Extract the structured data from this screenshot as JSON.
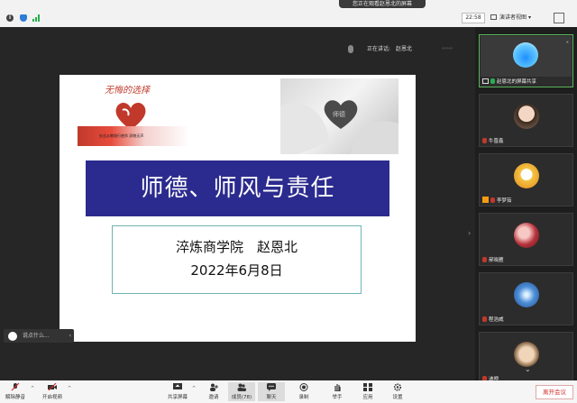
{
  "topbar": {
    "viewing_banner": "您正在观看赵恩北的屏幕",
    "time": "22:58",
    "view_mode": "演讲者视图"
  },
  "stage": {
    "speaking_label": "正在讲话:",
    "speaking_name": "赵恩北",
    "chat_placeholder": "说点什么...",
    "slide": {
      "brand_title": "无悔的选择",
      "heart_strip_text": "矢志从教践行使命 润物无声",
      "stone_label": "师德",
      "title": "师德、师风与责任",
      "college_line": "淬炼商学院　赵恩北",
      "date_line": "2022年6月8日"
    }
  },
  "panel": {
    "tiles": [
      {
        "label": "赵恩北的屏幕共享"
      },
      {
        "label": "牛晋鑫"
      },
      {
        "label": "李梦茹"
      },
      {
        "label": "郝晓雁"
      },
      {
        "label": "程浩威"
      },
      {
        "label": "迪呷"
      }
    ]
  },
  "toolbar": {
    "mute": "解除静音",
    "video": "开启视频",
    "share": "共享屏幕",
    "invite": "邀请",
    "members": "成员(78)",
    "chat": "聊天",
    "record": "录制",
    "raise_hand": "举手",
    "apps": "应用",
    "settings": "设置",
    "leave": "离开会议"
  },
  "colors": {
    "title_bar": "#2b2b8f",
    "leave_red": "#d32f2f",
    "active_speaker_green": "#5ab35a"
  }
}
